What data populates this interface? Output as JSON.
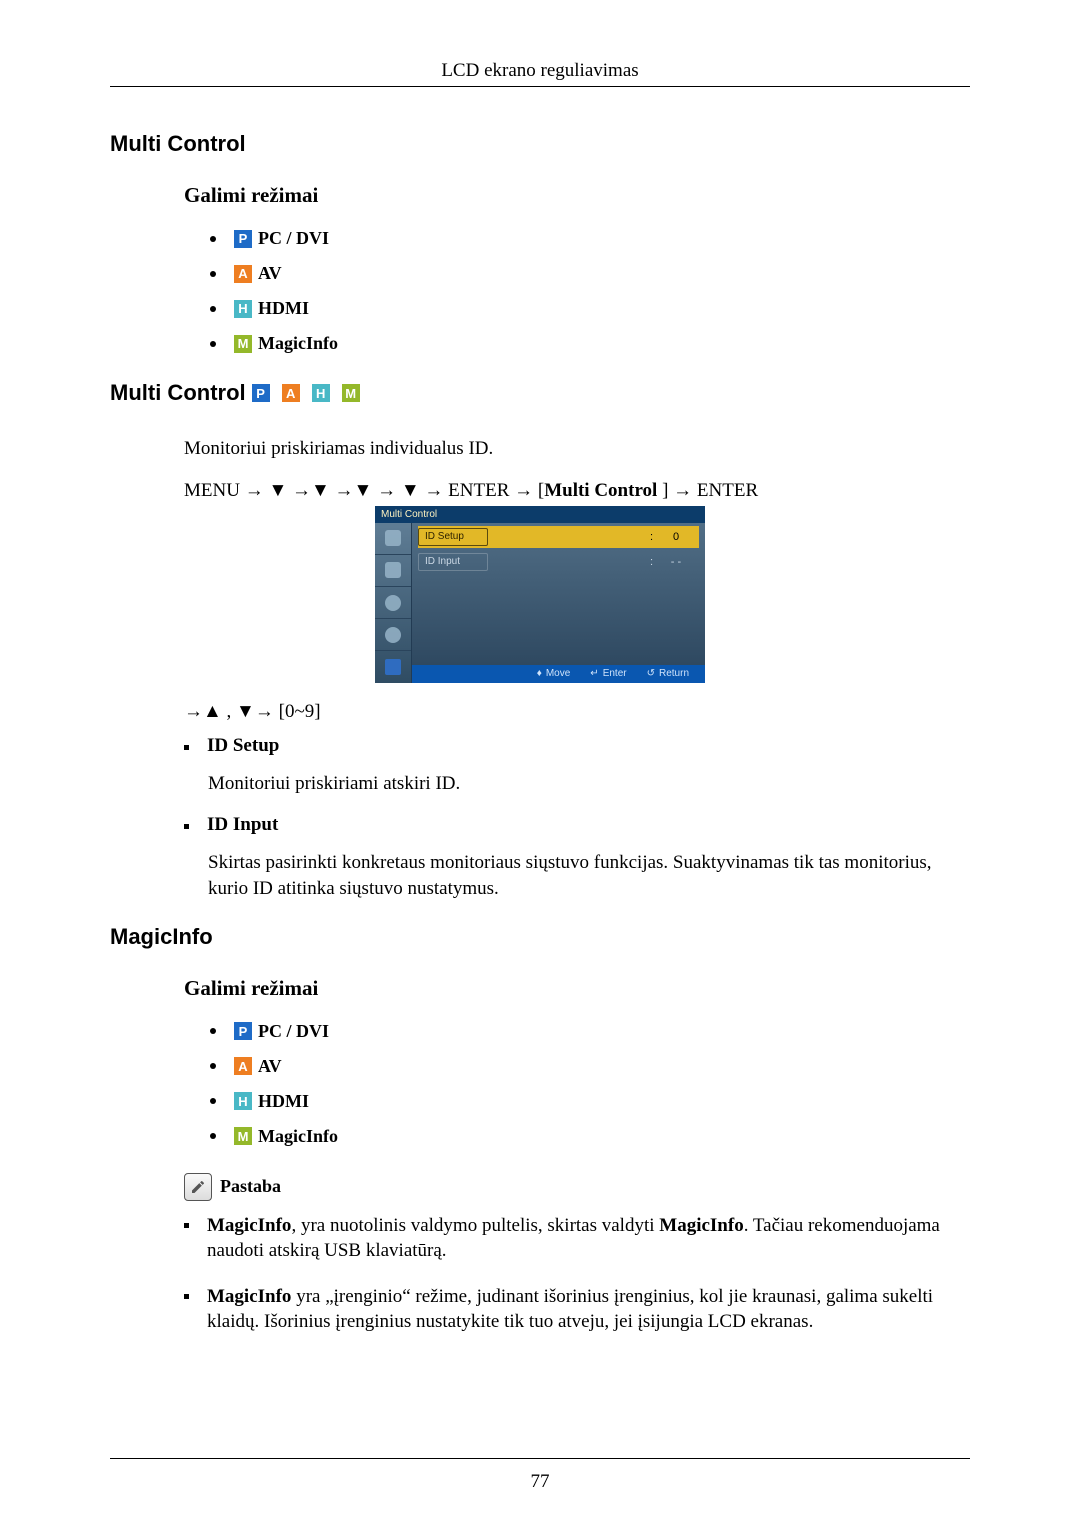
{
  "header": {
    "title": "LCD ekrano reguliavimas"
  },
  "page_number": "77",
  "sections": {
    "multiControl1": {
      "title": "Multi Control"
    },
    "modes1": {
      "title": "Galimi režimai",
      "items": [
        {
          "icon": "P",
          "label": "PC / DVI"
        },
        {
          "icon": "A",
          "label": "AV"
        },
        {
          "icon": "H",
          "label": "HDMI"
        },
        {
          "icon": "M",
          "label": "MagicInfo"
        }
      ]
    },
    "multiControl2": {
      "title": "Multi Control",
      "desc": "Monitoriui priskiriamas individualus ID.",
      "menupath": {
        "prefix": "MENU → ▼ →▼ →▼ → ▼ → ENTER → [",
        "bold": "Multi Control",
        "suffix": " ] → ENTER"
      },
      "navhint": "→▲ , ▼→ [0~9]"
    },
    "osd": {
      "title": "Multi Control",
      "rows": [
        {
          "label": "ID  Setup",
          "active": true,
          "value": "0"
        },
        {
          "label": "ID  Input",
          "active": false,
          "value": "- -"
        }
      ],
      "footer": {
        "move": "Move",
        "enter": "Enter",
        "return": "Return"
      }
    },
    "subitems": {
      "idSetup": {
        "title": "ID Setup",
        "desc": "Monitoriui priskiriami atskiri ID."
      },
      "idInput": {
        "title": "ID Input",
        "desc": "Skirtas pasirinkti konkretaus monitoriaus siųstuvo funkcijas. Suaktyvinamas tik tas monitorius, kurio ID atitinka siųstuvo nustatymus."
      }
    },
    "magicInfo": {
      "title": "MagicInfo"
    },
    "modes2": {
      "title": "Galimi režimai",
      "items": [
        {
          "icon": "P",
          "label": "PC / DVI"
        },
        {
          "icon": "A",
          "label": "AV"
        },
        {
          "icon": "H",
          "label": "HDMI"
        },
        {
          "icon": "M",
          "label": "MagicInfo"
        }
      ]
    },
    "note": {
      "label": "Pastaba",
      "items": {
        "n1": {
          "b1": "MagicInfo",
          "t1": ", yra nuotolinis valdymo pultelis, skirtas valdyti ",
          "b2": "MagicInfo",
          "t2": ". Tačiau rekomenduojama naudoti atskirą USB klaviatūrą."
        },
        "n2": {
          "b1": "MagicInfo",
          "t1": " yra „įrenginio“ režime, judinant išorinius įrenginius, kol jie kraunasi, galima sukelti klaidų. Išorinius įrenginius nustatykite tik tuo atveju, jei įsijungia LCD ekranas."
        }
      }
    }
  }
}
